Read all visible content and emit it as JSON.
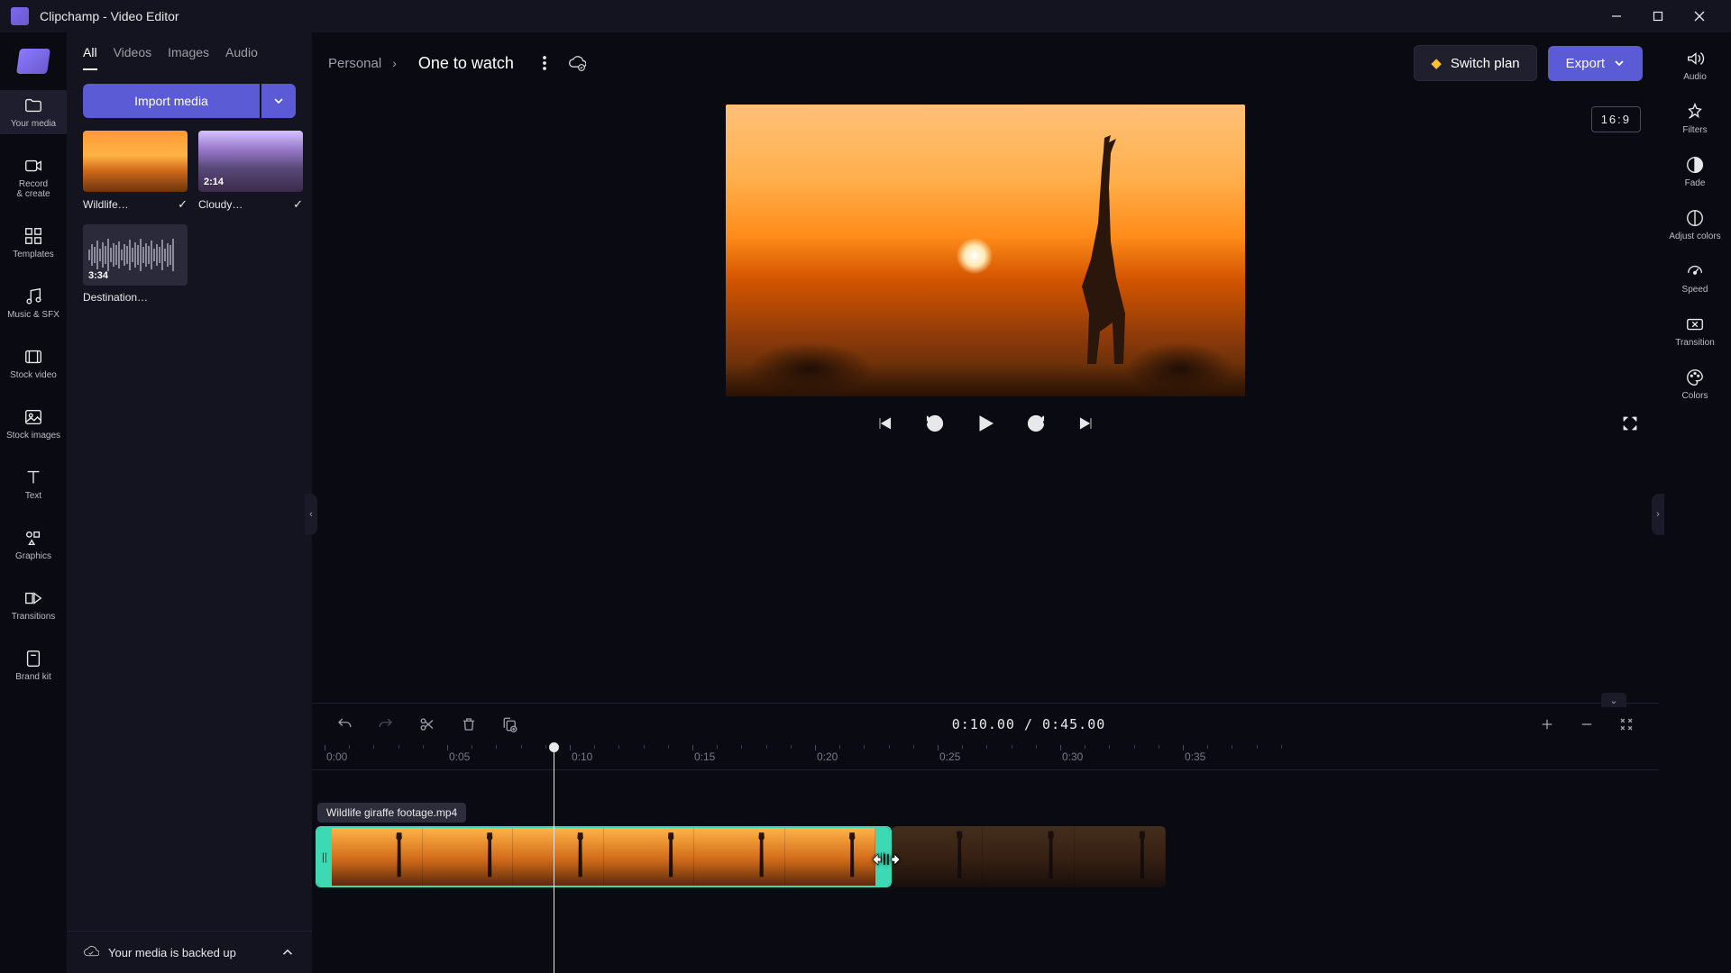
{
  "titlebar": {
    "title": "Clipchamp - Video Editor"
  },
  "leftRail": {
    "yourMedia": "Your media",
    "recordCreate": "Record\n& create",
    "templates": "Templates",
    "musicSfx": "Music & SFX",
    "stockVideo": "Stock video",
    "stockImages": "Stock images",
    "text": "Text",
    "graphics": "Graphics",
    "transitions": "Transitions",
    "brandKit": "Brand kit"
  },
  "mediaPanel": {
    "tabs": [
      "All",
      "Videos",
      "Images",
      "Audio"
    ],
    "importLabel": "Import media",
    "items": [
      {
        "name": "Wildlife…",
        "duration": "",
        "checked": true
      },
      {
        "name": "Cloudy…",
        "duration": "2:14",
        "checked": true
      },
      {
        "name": "Destination…",
        "duration": "3:34",
        "checked": false,
        "audio": true
      }
    ],
    "backup": "Your media is backed up"
  },
  "topBar": {
    "breadcrumb": "Personal",
    "projectName": "One to watch",
    "switchPlan": "Switch plan",
    "export": "Export"
  },
  "preview": {
    "aspect": "16:9"
  },
  "timeline": {
    "time": "0:10.00 / 0:45.00",
    "ticks": [
      "0:00",
      "0:05",
      "0:10",
      "0:15",
      "0:20",
      "0:25",
      "0:30",
      "0:35"
    ],
    "clipTooltip": "Wildlife giraffe footage.mp4"
  },
  "rightRail": {
    "audio": "Audio",
    "filters": "Filters",
    "fade": "Fade",
    "adjustColors": "Adjust colors",
    "speed": "Speed",
    "transition": "Transition",
    "colors": "Colors"
  }
}
